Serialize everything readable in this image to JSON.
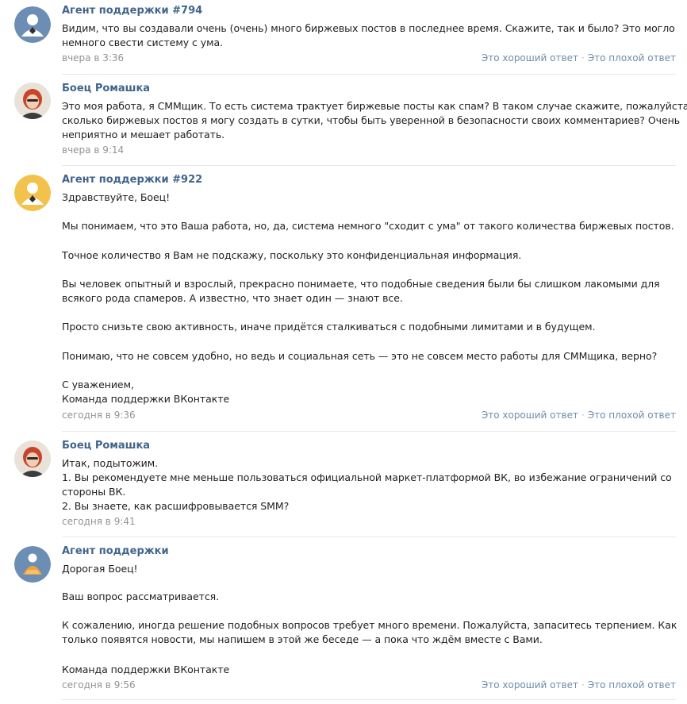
{
  "messages": [
    {
      "author": "Агент поддержки #794",
      "lines": [
        "Видим, что вы создавали очень (очень) много биржевых постов в последнее время. Скажите, так и было? Это могло",
        "немного свести систему с ума."
      ],
      "time": "вчера в 3:36",
      "rating": {
        "good": "Это хороший ответ",
        "sep": "·",
        "bad": "Это плохой ответ"
      }
    },
    {
      "author": "Боец Ромашка",
      "lines": [
        "Это моя работа, я СММщик. То есть система трактует биржевые посты как спам? В таком случае скажите, пожалуйста,",
        "сколько биржевых постов я могу создать в сутки, чтобы быть уверенной в безопасности своих комментариев? Очень",
        "неприятно и мешает работать."
      ],
      "time": "вчера в 9:14"
    },
    {
      "author": "Агент поддержки #922",
      "lines": [
        "Здравствуйте, Боец!",
        "Мы понимаем, что это Ваша работа, но, да, система немного \"сходит с ума\" от такого количества биржевых постов.",
        "Точное количество я Вам не подскажу, поскольку это конфиденциальная информация.",
        "Вы человек опытный и взрослый, прекрасно понимаете, что подобные сведения были бы слишком лакомыми для",
        "всякого рода спамеров. А известно, что знает один — знают все.",
        "Просто снизьте свою активность, иначе придётся сталкиваться с подобными лимитами и в будущем.",
        "Понимаю, что не совсем удобно, но ведь и социальная сеть — это не совсем место работы для СММщика, верно?",
        "С уважением,",
        "Команда поддержки ВКонтакте"
      ],
      "time": "сегодня в 9:36",
      "rating": {
        "good": "Это хороший ответ",
        "sep": "·",
        "bad": "Это плохой ответ"
      }
    },
    {
      "author": "Боец Ромашка",
      "lines": [
        "Итак, подытожим.",
        "1. Вы рекомендуете мне меньше пользоваться официальной маркет-платформой ВК, во избежание ограничений со",
        "стороны ВК.",
        "2. Вы знаете, как расшифровывается SMM?"
      ],
      "time": "сегодня в 9:41"
    },
    {
      "author": "Агент поддержки",
      "lines": [
        "Дорогая Боец!",
        "Ваш вопрос рассматривается.",
        "К сожалению, иногда решение подобных вопросов требует много времени. Пожалуйста, запаситесь терпением. Как",
        "только появятся новости, мы напишем в этой же беседе — а пока что ждём вместе с Вами.",
        "Команда поддержки ВКонтакте"
      ],
      "time": "сегодня в 9:56",
      "rating": {
        "good": "Это хороший ответ",
        "sep": "·",
        "bad": "Это плохой ответ"
      }
    }
  ],
  "colors": {
    "author": "#42648b",
    "link": "#6f8cab",
    "time": "#939393",
    "divider": "#e6e8eb",
    "agent_avatar_bg": "#6d8eb4",
    "user_avatar_hair": "#c8442c"
  },
  "icons": {
    "agent_avatar": "agent-avatar-icon",
    "user_avatar": "user-photo-avatar"
  }
}
